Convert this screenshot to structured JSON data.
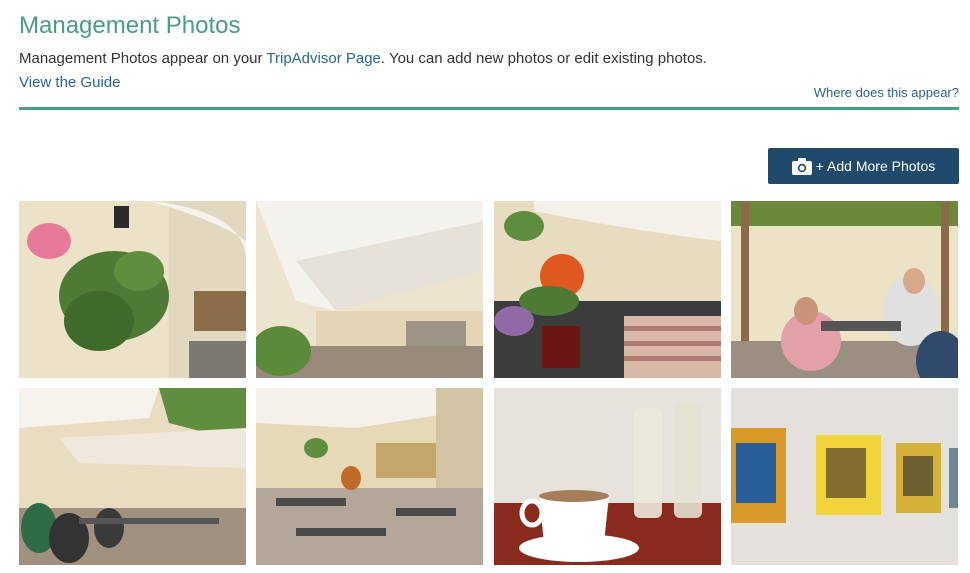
{
  "header": {
    "title": "Management Photos",
    "desc_prefix": "Management Photos appear on your ",
    "desc_link": "TripAdvisor Page",
    "desc_suffix": ". You can add new photos or edit existing photos.",
    "guide_link": "View the Guide",
    "where_link": "Where does this appear?"
  },
  "toolbar": {
    "add_label": "+ Add More Photos",
    "icon": "camera-icon"
  },
  "colors": {
    "accent": "#4a9e80",
    "link": "#2a6496",
    "button_bg": "#1f4a6b"
  },
  "photos": [
    {
      "name": "photo-hanging-plant"
    },
    {
      "name": "photo-courtyard-awning"
    },
    {
      "name": "photo-table-flower"
    },
    {
      "name": "photo-pergola-diners"
    },
    {
      "name": "photo-terrace-guests"
    },
    {
      "name": "photo-courtyard-wide"
    },
    {
      "name": "photo-coffee-cup"
    },
    {
      "name": "photo-wall-paintings"
    }
  ]
}
